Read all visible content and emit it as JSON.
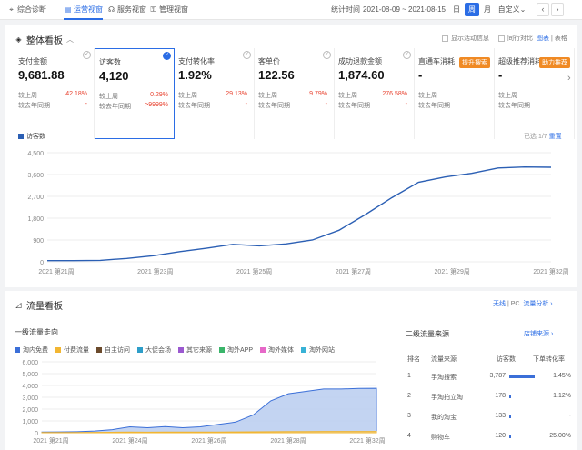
{
  "nav": {
    "items": [
      {
        "label": "综合诊断",
        "icon": "location-pin-icon",
        "active": false
      },
      {
        "label": "运营视窗",
        "icon": "document-icon",
        "active": true
      },
      {
        "label": "服务视窗",
        "icon": "headset-icon",
        "active": false
      },
      {
        "label": "管理视窗",
        "icon": "lock-icon",
        "active": false
      }
    ],
    "stat_label": "统计时间",
    "stat_range": "2021-08-09 ~ 2021-08-15",
    "period_buttons": [
      "日",
      "周",
      "月",
      "自定义"
    ],
    "active_period": "周"
  },
  "overview": {
    "title": "整体看板",
    "show_events": "显示活动信息",
    "peer_compare": "同行对比",
    "view_chart": "图表",
    "view_table": "表格",
    "cards": [
      {
        "label": "支付金额",
        "value": "9,681.88",
        "r1": "较上周",
        "p1": "42.18%",
        "r2": "较去年同期",
        "p2": "-",
        "selected": false
      },
      {
        "label": "访客数",
        "value": "4,120",
        "r1": "较上周",
        "p1": "0.29%",
        "r2": "较去年同期",
        "p2": ">9999%",
        "selected": true
      },
      {
        "label": "支付转化率",
        "value": "1.92%",
        "r1": "较上周",
        "p1": "29.13%",
        "r2": "较去年同期",
        "p2": "-",
        "selected": false
      },
      {
        "label": "客单价",
        "value": "122.56",
        "r1": "较上周",
        "p1": "9.79%",
        "r2": "较去年同期",
        "p2": "-",
        "selected": false
      },
      {
        "label": "成功退款金额",
        "value": "1,874.60",
        "r1": "较上周",
        "p1": "276.58%",
        "r2": "较去年同期",
        "p2": "-",
        "selected": false
      },
      {
        "label": "直通车消耗",
        "value": "-",
        "r1": "较上周",
        "p1": "",
        "r2": "较去年同期",
        "p2": "",
        "tag": "提升搜索",
        "selected": false
      },
      {
        "label": "超级推荐消耗",
        "value": "-",
        "r1": "较上周",
        "p1": "",
        "r2": "较去年同期",
        "p2": "",
        "tag": "助力推荐",
        "selected": false
      }
    ],
    "chart_legend": "访客数",
    "selected_info": "已选 1/7",
    "reset": "重置"
  },
  "chart_data": [
    {
      "type": "line",
      "title": "",
      "series": [
        {
          "name": "访客数",
          "values": [
            50,
            50,
            60,
            140,
            250,
            420,
            560,
            720,
            660,
            740,
            900,
            1300,
            1950,
            2650,
            3280,
            3500,
            3650,
            3870,
            3910,
            3900
          ]
        }
      ],
      "x_ticks": [
        "2021 第21周",
        "2021 第23周",
        "2021 第25周",
        "2021 第27周",
        "2021 第29周",
        "2021 第32周"
      ],
      "y_ticks": [
        "0",
        "900",
        "1,800",
        "2,700",
        "3,600",
        "4,500"
      ],
      "ylim": [
        0,
        4500
      ],
      "grid": true,
      "color": "#2b5fb4"
    },
    {
      "type": "area",
      "title": "",
      "series": [
        {
          "name": "淘内免费",
          "values": [
            60,
            70,
            90,
            140,
            260,
            500,
            420,
            520,
            420,
            500,
            700,
            900,
            1500,
            2700,
            3300,
            3500,
            3700,
            3700,
            3750,
            3760
          ]
        },
        {
          "name": "付费流量",
          "values": [
            20,
            20,
            20,
            30,
            40,
            60,
            50,
            60,
            60,
            60,
            60,
            70,
            80,
            90,
            100,
            100,
            110,
            110,
            110,
            110
          ]
        }
      ],
      "x_ticks": [
        "2021 第21周",
        "2021 第24周",
        "2021 第26周",
        "2021 第28周",
        "2021 第32周"
      ],
      "y_ticks": [
        "0",
        "1,000",
        "2,000",
        "3,000",
        "4,000",
        "5,000",
        "6,000"
      ],
      "ylim": [
        0,
        6000
      ],
      "grid": true
    }
  ],
  "traffic": {
    "title": "流量看板",
    "device": "无线",
    "device2": "PC",
    "analysis": "流量分析",
    "left_title": "一级流量走向",
    "legend": [
      {
        "label": "淘内免费",
        "color": "#3b6fd8"
      },
      {
        "label": "付费流量",
        "color": "#f2b632"
      },
      {
        "label": "自主访问",
        "color": "#6b4a2c"
      },
      {
        "label": "大促会场",
        "color": "#2e9ec9"
      },
      {
        "label": "其它来源",
        "color": "#9b59d0"
      },
      {
        "label": "淘外APP",
        "color": "#3ab56a"
      },
      {
        "label": "淘外媒体",
        "color": "#e668c8"
      },
      {
        "label": "淘外网站",
        "color": "#38b2d6"
      }
    ],
    "right_title": "二级流量来源",
    "shop_traffic": "店铺来源",
    "col_rank": "排名",
    "col_source": "流量来源",
    "col_visitors": "访客数",
    "col_conv": "下单转化率",
    "rows": [
      {
        "rank": "1",
        "source": "手淘搜索",
        "visitors": "3,787",
        "bar": 1.0,
        "conv": "1.45%"
      },
      {
        "rank": "2",
        "source": "手淘拍立淘",
        "visitors": "178",
        "bar": 0.05,
        "conv": "1.12%"
      },
      {
        "rank": "3",
        "source": "我的淘宝",
        "visitors": "133",
        "bar": 0.04,
        "conv": "-"
      },
      {
        "rank": "4",
        "source": "购物车",
        "visitors": "120",
        "bar": 0.03,
        "conv": "25.00%"
      }
    ]
  }
}
